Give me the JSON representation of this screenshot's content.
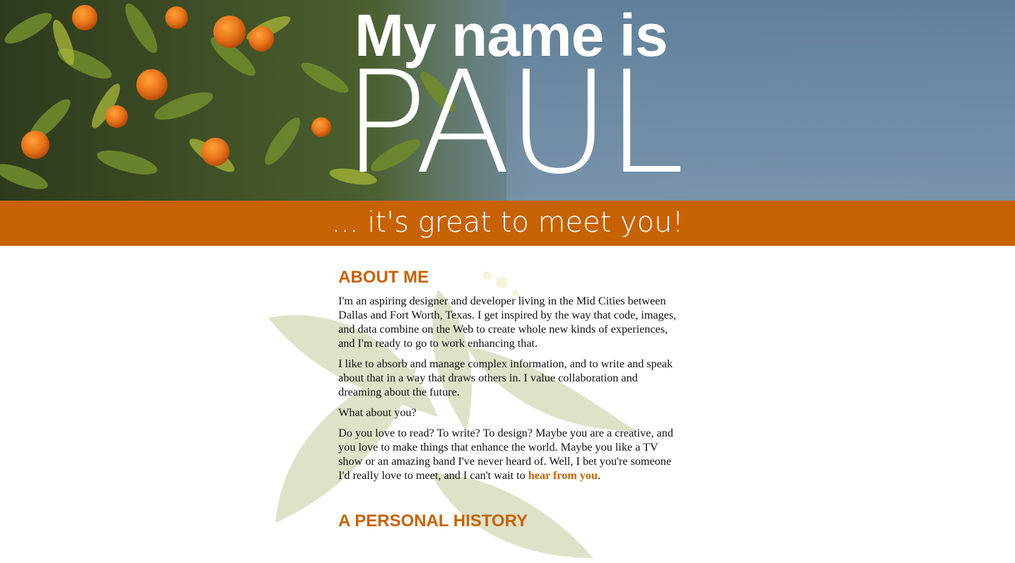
{
  "hero": {
    "title_top": "My name is",
    "title_name": "PAUL"
  },
  "band": {
    "tagline": "... it's great to meet you!"
  },
  "about": {
    "heading": "ABOUT ME",
    "p1": "I'm an aspiring designer and developer living in the Mid Cities between Dallas and Fort Worth, Texas. I get inspired by the way that code, images, and data combine on the Web to create whole new kinds of experiences, and I'm ready to go to work enhancing that.",
    "p2": "I like to absorb and manage complex information, and to write and speak about that in a way that draws others in. I value collaboration and dreaming about the future.",
    "p3": "What about you?",
    "p4_text": "Do you love to read? To write? To design? Maybe you are a creative, and you love to make things that enhance the world. Maybe you like a TV show or an amazing band I've never heard of. Well, I bet you're someone I'd really love to meet, and I can't wait to ",
    "p4_link": "hear from you",
    "p4_end": "."
  },
  "history": {
    "heading": "A PERSONAL HISTORY"
  },
  "colors": {
    "accent": "#c66203",
    "sky": "#6d8aa2",
    "leaf": "#566b31",
    "orange_fruit": "#e8741a"
  }
}
